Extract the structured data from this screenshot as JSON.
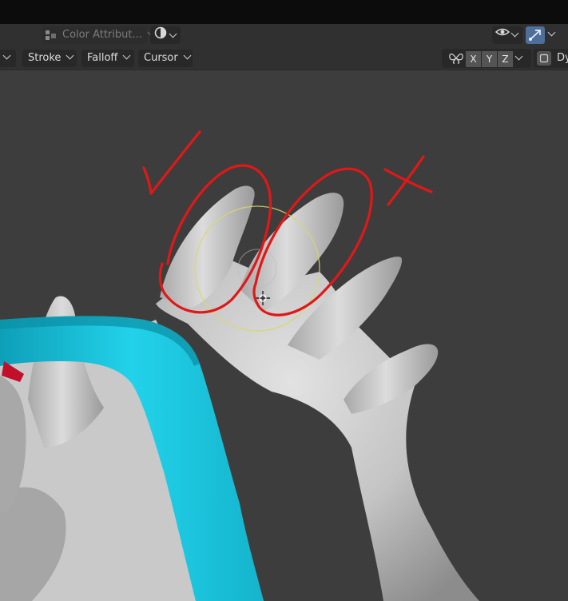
{
  "header": {
    "color_attribute_label": "Color Attribut...",
    "icons": [
      "color-attribute-icon",
      "shading-sphere-icon",
      "visibility-eye-icon",
      "gizmo-icon"
    ]
  },
  "toolbar": {
    "stroke_label": "Stroke",
    "falloff_label": "Falloff",
    "cursor_label": "Cursor",
    "symmetry_axes": [
      "X",
      "Y",
      "Z"
    ],
    "dyntopo_label": "Dy"
  },
  "colors": {
    "annotation": "#e01818",
    "strap": "#17c6e0",
    "brush_circle": "#d8d86a",
    "accent": "#4e6f9a"
  }
}
